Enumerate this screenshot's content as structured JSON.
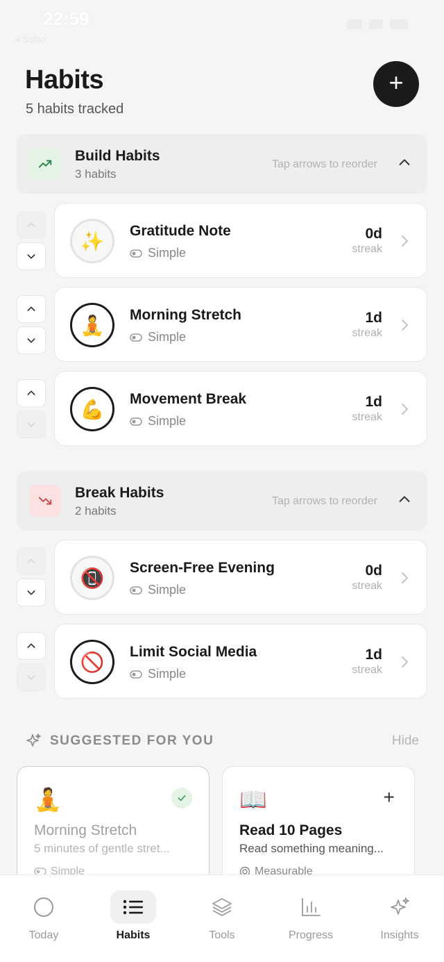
{
  "status_bar": {
    "time": "22:59",
    "back_label": "◂ Safari"
  },
  "header": {
    "title": "Habits",
    "subtitle": "5 habits tracked",
    "add_label": "+"
  },
  "sections": {
    "build": {
      "name": "Build Habits",
      "count": "3 habits",
      "hint": "Tap arrows to reorder",
      "badge_color": "#e3f3e6",
      "icon_color": "#2e7d46"
    },
    "break": {
      "name": "Break Habits",
      "count": "2 habits",
      "hint": "Tap arrows to reorder",
      "badge_color": "#fbe1e1",
      "icon_color": "#c94a4a"
    }
  },
  "habits": [
    {
      "emoji": "✨",
      "name": "Gratitude Note",
      "type": "Simple",
      "streak": "0d",
      "streak_label": "streak"
    },
    {
      "emoji": "🧘",
      "name": "Morning Stretch",
      "type": "Simple",
      "streak": "1d",
      "streak_label": "streak"
    },
    {
      "emoji": "💪",
      "name": "Movement Break",
      "type": "Simple",
      "streak": "1d",
      "streak_label": "streak"
    },
    {
      "emoji": "📵",
      "name": "Screen-Free Evening",
      "type": "Simple",
      "streak": "0d",
      "streak_label": "streak"
    },
    {
      "emoji": "🚫",
      "name": "Limit Social Media",
      "type": "Simple",
      "streak": "1d",
      "streak_label": "streak"
    }
  ],
  "suggestions": {
    "label": "SUGGESTED FOR YOU",
    "hide_label": "Hide",
    "items": [
      {
        "emoji": "🧘",
        "name": "Morning Stretch",
        "desc": "5 minutes of gentle stret...",
        "type": "Simple",
        "added": true
      },
      {
        "emoji": "📖",
        "name": "Read 10 Pages",
        "desc": "Read something meaning...",
        "type": "Measurable",
        "added": false,
        "add_label": "+"
      }
    ]
  },
  "tabs": [
    {
      "label": "Today",
      "icon": "circle-icon",
      "active": false
    },
    {
      "label": "Habits",
      "icon": "list-icon",
      "active": true
    },
    {
      "label": "Tools",
      "icon": "layers-icon",
      "active": false
    },
    {
      "label": "Progress",
      "icon": "bar-chart-icon",
      "active": false
    },
    {
      "label": "Insights",
      "icon": "sparkles-icon",
      "active": false
    }
  ]
}
